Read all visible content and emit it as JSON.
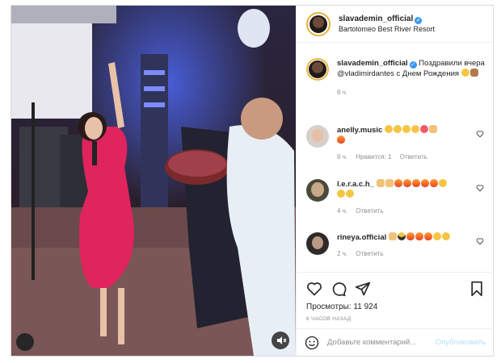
{
  "post": {
    "username": "slavademin_official",
    "location": "Bartolomeo Best River Resort"
  },
  "caption": {
    "username": "slavademin_official",
    "text": "Поздравили вчера @vladimirdantes с Днем Рождения",
    "time": "6 ч."
  },
  "comments": [
    {
      "username": "anelly.music",
      "time": "6 ч.",
      "likes": "Нравится: 1",
      "reply": "Ответить",
      "emoji": [
        "laugh",
        "laugh",
        "laugh",
        "laugh",
        "love",
        "hands-up",
        "fire"
      ]
    },
    {
      "username": "l.e.r.a.c.h_",
      "time": "4 ч.",
      "reply": "Ответить",
      "emoji": [
        "clap",
        "clap",
        "fire",
        "fire",
        "fire",
        "fire",
        "fire",
        "laugh",
        "laugh",
        "laugh"
      ]
    },
    {
      "username": "rineya.official",
      "time": "2 ч.",
      "reply": "Ответить",
      "emoji": [
        "victory",
        "cool",
        "fire",
        "fire",
        "fire",
        "laugh",
        "laugh"
      ]
    }
  ],
  "stats": {
    "views_label": "Просмотры:",
    "views_count": "11 924",
    "posted_ago": "6 ЧАСОВ НАЗАД"
  },
  "add_comment": {
    "placeholder": "Добавьте комментарий...",
    "post_label": "Опубликовать"
  },
  "icons": {
    "like": "heart-icon",
    "comment": "comment-icon",
    "share": "share-icon",
    "save": "bookmark-icon",
    "emoji": "smile-icon",
    "sound": "speaker-muted-icon"
  },
  "colors": {
    "verified": "#3897f0",
    "post_button": "#b2dffc",
    "secondary_text": "#8e8e8e"
  }
}
